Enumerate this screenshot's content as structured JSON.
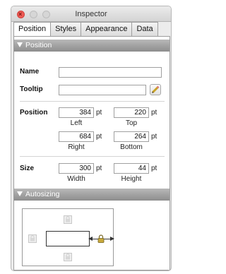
{
  "window": {
    "title": "Inspector"
  },
  "tabs": [
    {
      "label": "Position",
      "active": true
    },
    {
      "label": "Styles",
      "active": false
    },
    {
      "label": "Appearance",
      "active": false
    },
    {
      "label": "Data",
      "active": false
    }
  ],
  "position_section": {
    "header": "Position",
    "name_label": "Name",
    "name_value": "",
    "tooltip_label": "Tooltip",
    "tooltip_value": "",
    "position_label": "Position",
    "left": {
      "value": "384",
      "unit": "pt",
      "label": "Left"
    },
    "top": {
      "value": "220",
      "unit": "pt",
      "label": "Top"
    },
    "right": {
      "value": "684",
      "unit": "pt",
      "label": "Right"
    },
    "bottom": {
      "value": "264",
      "unit": "pt",
      "label": "Bottom"
    },
    "size_label": "Size",
    "width": {
      "value": "300",
      "unit": "pt",
      "label": "Width"
    },
    "height": {
      "value": "44",
      "unit": "pt",
      "label": "Height"
    }
  },
  "autosizing_section": {
    "header": "Autosizing"
  },
  "icons": {
    "close": "close-icon",
    "minimize": "minimize-icon",
    "zoom": "zoom-icon",
    "disclosure": "disclosure-triangle-icon",
    "pencil": "pencil-icon",
    "lock": "lock-icon"
  },
  "colors": {
    "close_button": "#ee5b55",
    "section_header": "#9d9d9d",
    "lock_active": "#c9a93a"
  }
}
